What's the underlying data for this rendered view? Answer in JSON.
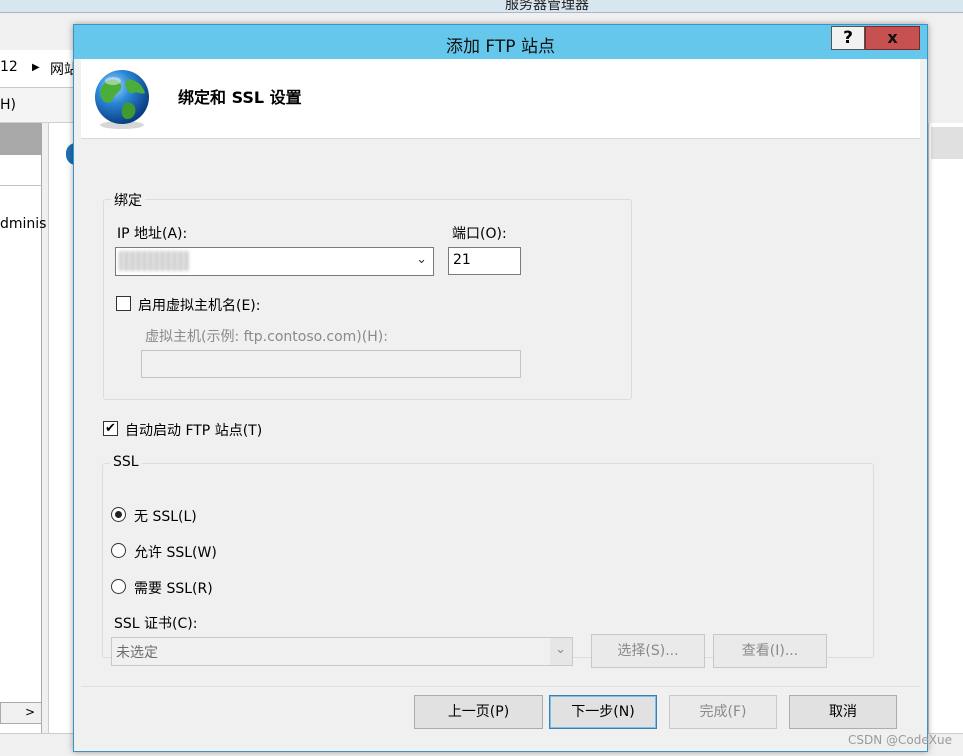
{
  "background": {
    "window_title": "服务器管理器",
    "address_prefix": "12",
    "address_segment": "网站",
    "menu_fragment": "H)",
    "panel_text": "dminis"
  },
  "dialog": {
    "title": "添加 FTP 站点",
    "help_label": "?",
    "close_label": "x",
    "header_title": "绑定和 SSL 设置"
  },
  "binding": {
    "group_label": "绑定",
    "ip_label": "IP 地址(A):",
    "port_label": "端口(O):",
    "port_value": "21",
    "virtual_host_checkbox_label": "启用虚拟主机名(E):",
    "virtual_host_checked": false,
    "virtual_host_label": "虚拟主机(示例: ftp.contoso.com)(H):",
    "virtual_host_value": ""
  },
  "autostart": {
    "label": "自动启动 FTP 站点(T)",
    "checked": true
  },
  "ssl": {
    "group_label": "SSL",
    "options": [
      {
        "label": "无 SSL(L)",
        "checked": true
      },
      {
        "label": "允许 SSL(W)",
        "checked": false
      },
      {
        "label": "需要 SSL(R)",
        "checked": false
      }
    ],
    "cert_label": "SSL 证书(C):",
    "cert_value": "未选定",
    "select_button": "选择(S)...",
    "view_button": "查看(I)..."
  },
  "footer": {
    "prev_button": "上一页(P)",
    "next_button": "下一步(N)",
    "finish_button": "完成(F)",
    "cancel_button": "取消"
  },
  "watermark": "CSDN @CodeXue",
  "colors": {
    "titlebar": "#64c7eb",
    "close_button": "#c75050",
    "dialog_bg": "#f0f0f0"
  }
}
